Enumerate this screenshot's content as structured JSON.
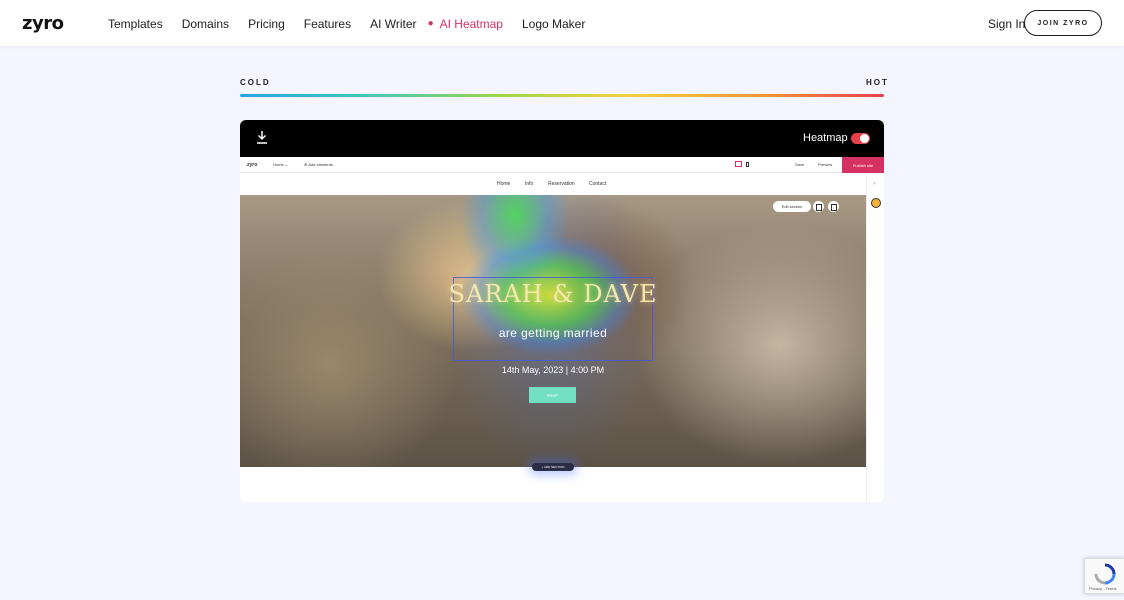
{
  "nav": {
    "logo": "zyro",
    "links": [
      "Templates",
      "Domains",
      "Pricing",
      "Features",
      "AI Writer",
      "AI Heatmap",
      "Logo Maker"
    ],
    "active_link": "AI Heatmap",
    "sign_in": "Sign In",
    "join": "JOIN ZYRO"
  },
  "scale": {
    "cold": "COLD",
    "hot": "HOT",
    "gradient_colors": [
      "#2aa3e6",
      "#46c6b6",
      "#9bd64c",
      "#f1d23b",
      "#f59a3a",
      "#e8404a"
    ]
  },
  "preview": {
    "heatmap_label": "Heatmap",
    "heatmap_enabled": true,
    "icons": {
      "download": "download-icon",
      "toggle": "toggle-switch"
    },
    "builder_bar": {
      "logo": "zyro",
      "home": "Home ⌄",
      "add_elements": "⊕ Add elements",
      "save": "Save",
      "preview": "Preview",
      "publish": "Publish site"
    },
    "site_nav": [
      "Home",
      "Info",
      "Reservation",
      "Contact"
    ],
    "hero": {
      "edit_section": "Edit section",
      "title": "SARAH & DAVE",
      "subtitle": "are getting married",
      "date": "14th May, 2023 | 4:00 PM",
      "rsvp": "RSVP"
    },
    "add_section": "+ ADD SECTION"
  },
  "recaptcha": {
    "text": "Privacy - Terms"
  },
  "colors": {
    "accent": "#d63163",
    "background": "#f4f5ff",
    "header_bar": "#000000"
  }
}
